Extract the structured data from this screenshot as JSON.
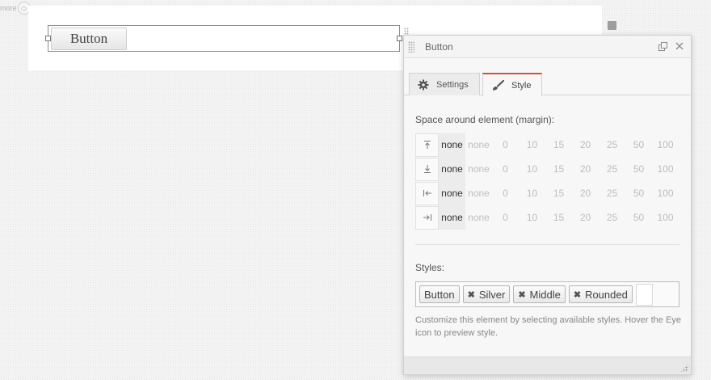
{
  "canvas": {
    "more_label": "more",
    "button_label": "Button"
  },
  "panel": {
    "title": "Button",
    "tabs": [
      {
        "label": "Settings",
        "icon": "gear-icon",
        "active": false
      },
      {
        "label": "Style",
        "icon": "paintbrush-icon",
        "active": true
      }
    ],
    "accent_color": "#c9573e",
    "margin": {
      "label": "Space around element (margin):",
      "rows": [
        {
          "side": "top",
          "icon": "margin-top-icon",
          "current": "none"
        },
        {
          "side": "bottom",
          "icon": "margin-bottom-icon",
          "current": "none"
        },
        {
          "side": "left",
          "icon": "margin-left-icon",
          "current": "none"
        },
        {
          "side": "right",
          "icon": "margin-right-icon",
          "current": "none"
        }
      ],
      "options": [
        "none",
        "0",
        "10",
        "15",
        "20",
        "25",
        "50",
        "100"
      ]
    },
    "styles": {
      "label": "Styles:",
      "chips": [
        {
          "label": "Button",
          "removable": false
        },
        {
          "label": "Silver",
          "removable": true
        },
        {
          "label": "Middle",
          "removable": true
        },
        {
          "label": "Rounded",
          "removable": true
        }
      ],
      "help_text": "Customize this element by selecting available styles. Hover the Eye icon to preview style."
    }
  }
}
